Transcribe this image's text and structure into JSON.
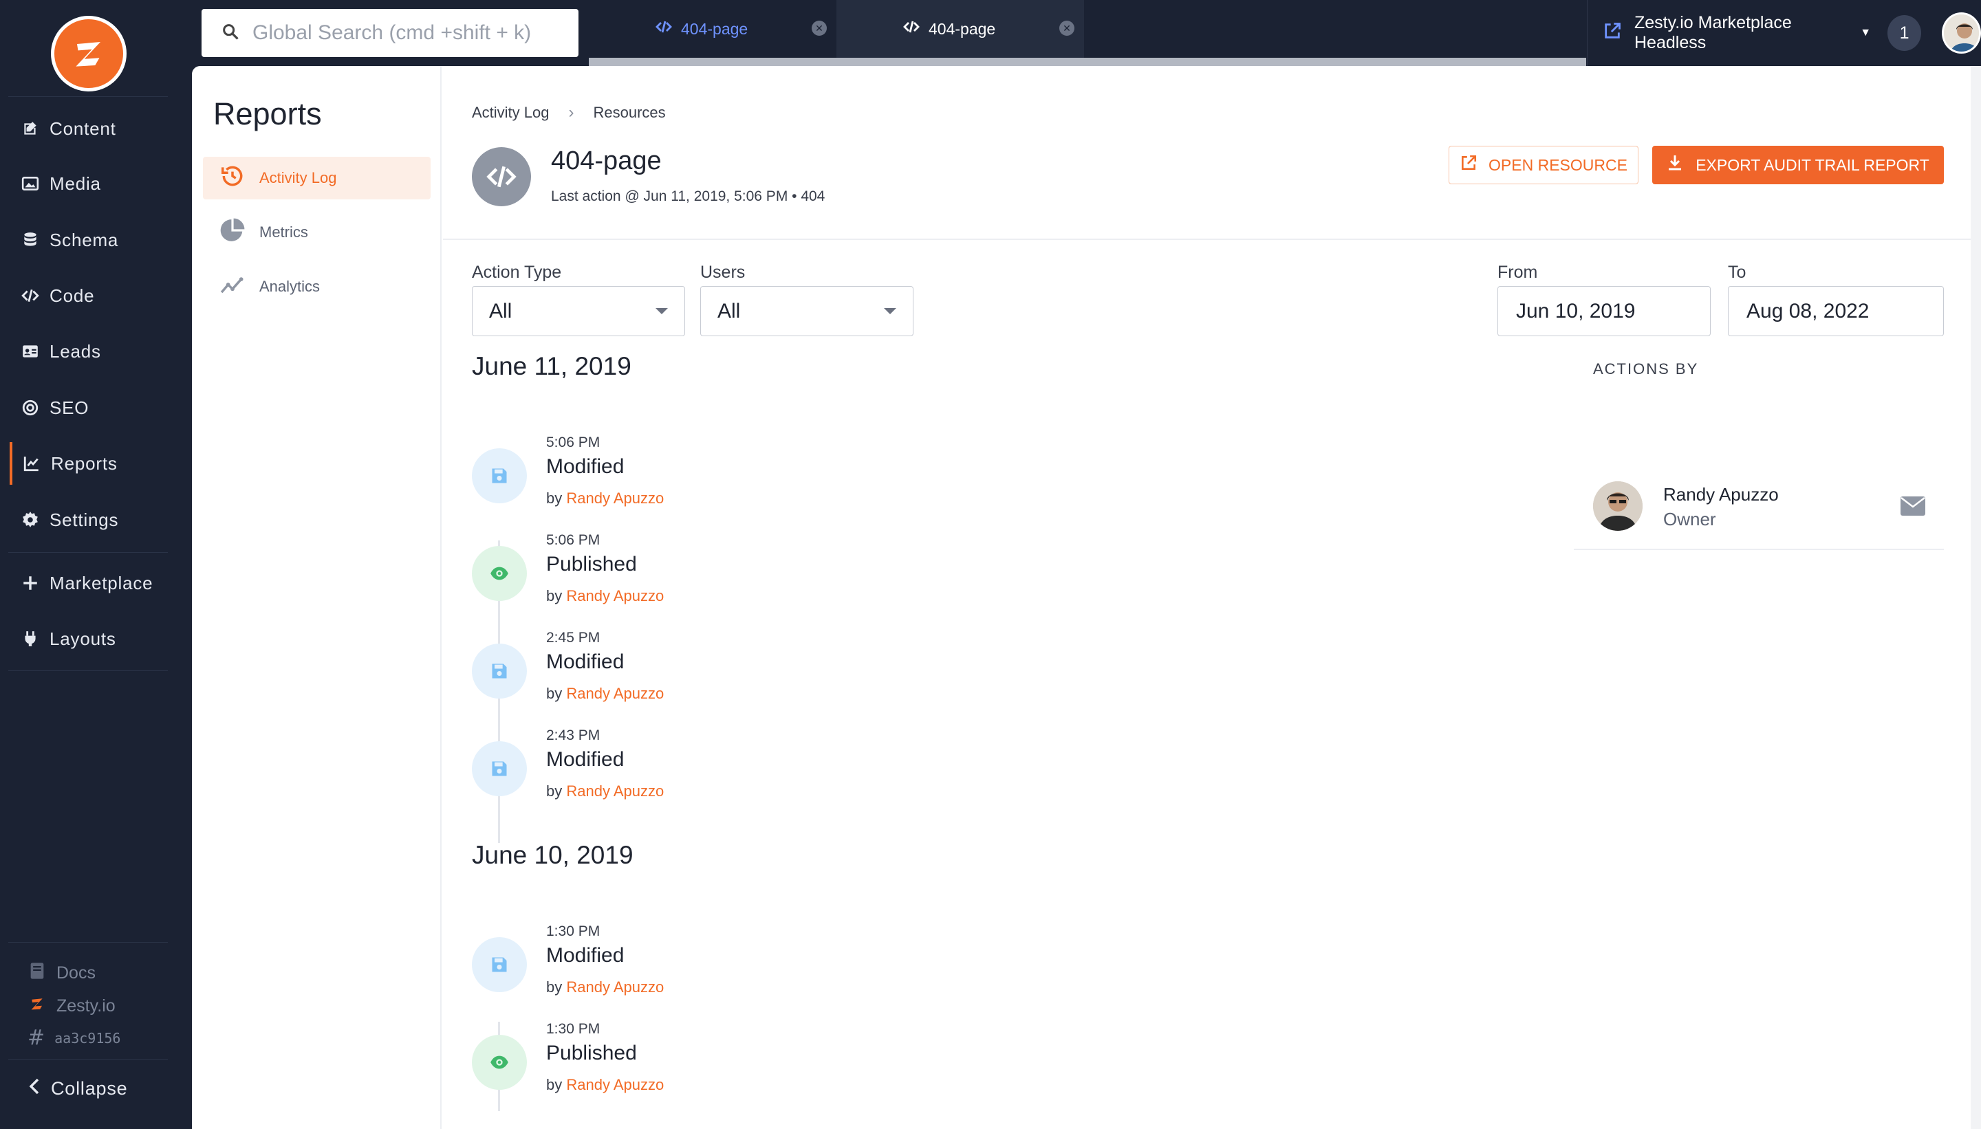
{
  "app_nav": {
    "items": [
      {
        "label": "Content",
        "icon": "edit-icon"
      },
      {
        "label": "Media",
        "icon": "image-icon"
      },
      {
        "label": "Schema",
        "icon": "database-icon"
      },
      {
        "label": "Code",
        "icon": "code-icon"
      },
      {
        "label": "Leads",
        "icon": "address-card-icon"
      },
      {
        "label": "SEO",
        "icon": "target-icon"
      },
      {
        "label": "Reports",
        "icon": "line-chart-icon"
      },
      {
        "label": "Settings",
        "icon": "gear-icon"
      },
      {
        "label": "Marketplace",
        "icon": "plus-icon"
      },
      {
        "label": "Layouts",
        "icon": "plug-icon"
      }
    ],
    "active": "Reports",
    "footer": {
      "docs": "Docs",
      "zesty": "Zesty.io",
      "hash": "aa3c9156"
    },
    "collapse": "Collapse"
  },
  "topbar": {
    "search_placeholder": "Global Search (cmd +shift + k)",
    "tabs": [
      {
        "label": "404-page",
        "active": false
      },
      {
        "label": "404-page",
        "active": true
      }
    ],
    "instance_name": "Zesty.io Marketplace Headless",
    "notification_count": "1"
  },
  "reports_nav": {
    "title": "Reports",
    "items": [
      {
        "label": "Activity Log",
        "icon": "history-icon",
        "active": true
      },
      {
        "label": "Metrics",
        "icon": "pie-chart-icon",
        "active": false
      },
      {
        "label": "Analytics",
        "icon": "analytics-icon",
        "active": false
      }
    ]
  },
  "breadcrumb": [
    "Activity Log",
    "Resources"
  ],
  "resource": {
    "title": "404-page",
    "last_action": "Last action @ Jun 11, 2019, 5:06 PM • 404"
  },
  "buttons": {
    "open_resource": "OPEN RESOURCE",
    "export": "EXPORT AUDIT TRAIL REPORT"
  },
  "filters": {
    "action_type_label": "Action Type",
    "action_type_value": "All",
    "users_label": "Users",
    "users_value": "All",
    "from_label": "From",
    "from_value": "Jun 10, 2019",
    "to_label": "To",
    "to_value": "Aug 08, 2022"
  },
  "timeline": [
    {
      "date": "June 11, 2019",
      "entries": [
        {
          "time": "5:06 PM",
          "action": "Modified",
          "by_prefix": "by",
          "user": "Randy Apuzzo",
          "kind": "modified"
        },
        {
          "time": "5:06 PM",
          "action": "Published",
          "by_prefix": "by",
          "user": "Randy Apuzzo",
          "kind": "published"
        },
        {
          "time": "2:45 PM",
          "action": "Modified",
          "by_prefix": "by",
          "user": "Randy Apuzzo",
          "kind": "modified"
        },
        {
          "time": "2:43 PM",
          "action": "Modified",
          "by_prefix": "by",
          "user": "Randy Apuzzo",
          "kind": "modified"
        }
      ]
    },
    {
      "date": "June 10, 2019",
      "entries": [
        {
          "time": "1:30 PM",
          "action": "Modified",
          "by_prefix": "by",
          "user": "Randy Apuzzo",
          "kind": "modified"
        },
        {
          "time": "1:30 PM",
          "action": "Published",
          "by_prefix": "by",
          "user": "Randy Apuzzo",
          "kind": "published"
        }
      ]
    }
  ],
  "actions_by": {
    "title": "ACTIONS BY",
    "users": [
      {
        "name": "Randy Apuzzo",
        "role": "Owner"
      }
    ]
  },
  "colors": {
    "accent": "#f26b26",
    "nav_bg": "#1b2233",
    "modified": "#7cc0f5",
    "published": "#3fb86a"
  }
}
